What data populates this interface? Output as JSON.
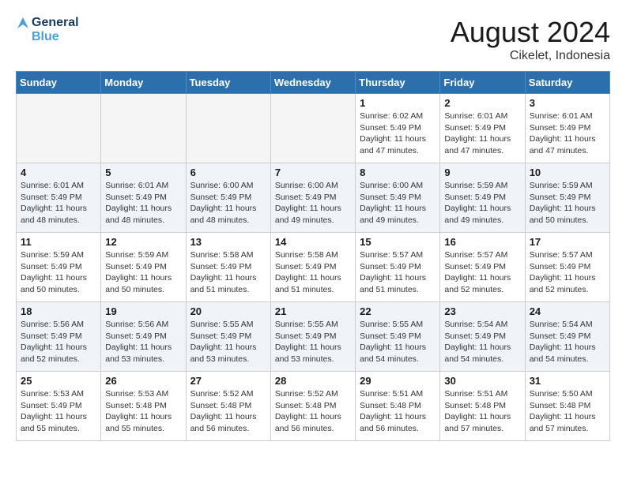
{
  "header": {
    "logo_line1": "General",
    "logo_line2": "Blue",
    "month_year": "August 2024",
    "location": "Cikelet, Indonesia"
  },
  "weekdays": [
    "Sunday",
    "Monday",
    "Tuesday",
    "Wednesday",
    "Thursday",
    "Friday",
    "Saturday"
  ],
  "weeks": [
    [
      {
        "day": "",
        "info": ""
      },
      {
        "day": "",
        "info": ""
      },
      {
        "day": "",
        "info": ""
      },
      {
        "day": "",
        "info": ""
      },
      {
        "day": "1",
        "info": "Sunrise: 6:02 AM\nSunset: 5:49 PM\nDaylight: 11 hours\nand 47 minutes."
      },
      {
        "day": "2",
        "info": "Sunrise: 6:01 AM\nSunset: 5:49 PM\nDaylight: 11 hours\nand 47 minutes."
      },
      {
        "day": "3",
        "info": "Sunrise: 6:01 AM\nSunset: 5:49 PM\nDaylight: 11 hours\nand 47 minutes."
      }
    ],
    [
      {
        "day": "4",
        "info": "Sunrise: 6:01 AM\nSunset: 5:49 PM\nDaylight: 11 hours\nand 48 minutes."
      },
      {
        "day": "5",
        "info": "Sunrise: 6:01 AM\nSunset: 5:49 PM\nDaylight: 11 hours\nand 48 minutes."
      },
      {
        "day": "6",
        "info": "Sunrise: 6:00 AM\nSunset: 5:49 PM\nDaylight: 11 hours\nand 48 minutes."
      },
      {
        "day": "7",
        "info": "Sunrise: 6:00 AM\nSunset: 5:49 PM\nDaylight: 11 hours\nand 49 minutes."
      },
      {
        "day": "8",
        "info": "Sunrise: 6:00 AM\nSunset: 5:49 PM\nDaylight: 11 hours\nand 49 minutes."
      },
      {
        "day": "9",
        "info": "Sunrise: 5:59 AM\nSunset: 5:49 PM\nDaylight: 11 hours\nand 49 minutes."
      },
      {
        "day": "10",
        "info": "Sunrise: 5:59 AM\nSunset: 5:49 PM\nDaylight: 11 hours\nand 50 minutes."
      }
    ],
    [
      {
        "day": "11",
        "info": "Sunrise: 5:59 AM\nSunset: 5:49 PM\nDaylight: 11 hours\nand 50 minutes."
      },
      {
        "day": "12",
        "info": "Sunrise: 5:59 AM\nSunset: 5:49 PM\nDaylight: 11 hours\nand 50 minutes."
      },
      {
        "day": "13",
        "info": "Sunrise: 5:58 AM\nSunset: 5:49 PM\nDaylight: 11 hours\nand 51 minutes."
      },
      {
        "day": "14",
        "info": "Sunrise: 5:58 AM\nSunset: 5:49 PM\nDaylight: 11 hours\nand 51 minutes."
      },
      {
        "day": "15",
        "info": "Sunrise: 5:57 AM\nSunset: 5:49 PM\nDaylight: 11 hours\nand 51 minutes."
      },
      {
        "day": "16",
        "info": "Sunrise: 5:57 AM\nSunset: 5:49 PM\nDaylight: 11 hours\nand 52 minutes."
      },
      {
        "day": "17",
        "info": "Sunrise: 5:57 AM\nSunset: 5:49 PM\nDaylight: 11 hours\nand 52 minutes."
      }
    ],
    [
      {
        "day": "18",
        "info": "Sunrise: 5:56 AM\nSunset: 5:49 PM\nDaylight: 11 hours\nand 52 minutes."
      },
      {
        "day": "19",
        "info": "Sunrise: 5:56 AM\nSunset: 5:49 PM\nDaylight: 11 hours\nand 53 minutes."
      },
      {
        "day": "20",
        "info": "Sunrise: 5:55 AM\nSunset: 5:49 PM\nDaylight: 11 hours\nand 53 minutes."
      },
      {
        "day": "21",
        "info": "Sunrise: 5:55 AM\nSunset: 5:49 PM\nDaylight: 11 hours\nand 53 minutes."
      },
      {
        "day": "22",
        "info": "Sunrise: 5:55 AM\nSunset: 5:49 PM\nDaylight: 11 hours\nand 54 minutes."
      },
      {
        "day": "23",
        "info": "Sunrise: 5:54 AM\nSunset: 5:49 PM\nDaylight: 11 hours\nand 54 minutes."
      },
      {
        "day": "24",
        "info": "Sunrise: 5:54 AM\nSunset: 5:49 PM\nDaylight: 11 hours\nand 54 minutes."
      }
    ],
    [
      {
        "day": "25",
        "info": "Sunrise: 5:53 AM\nSunset: 5:49 PM\nDaylight: 11 hours\nand 55 minutes."
      },
      {
        "day": "26",
        "info": "Sunrise: 5:53 AM\nSunset: 5:48 PM\nDaylight: 11 hours\nand 55 minutes."
      },
      {
        "day": "27",
        "info": "Sunrise: 5:52 AM\nSunset: 5:48 PM\nDaylight: 11 hours\nand 56 minutes."
      },
      {
        "day": "28",
        "info": "Sunrise: 5:52 AM\nSunset: 5:48 PM\nDaylight: 11 hours\nand 56 minutes."
      },
      {
        "day": "29",
        "info": "Sunrise: 5:51 AM\nSunset: 5:48 PM\nDaylight: 11 hours\nand 56 minutes."
      },
      {
        "day": "30",
        "info": "Sunrise: 5:51 AM\nSunset: 5:48 PM\nDaylight: 11 hours\nand 57 minutes."
      },
      {
        "day": "31",
        "info": "Sunrise: 5:50 AM\nSunset: 5:48 PM\nDaylight: 11 hours\nand 57 minutes."
      }
    ]
  ]
}
